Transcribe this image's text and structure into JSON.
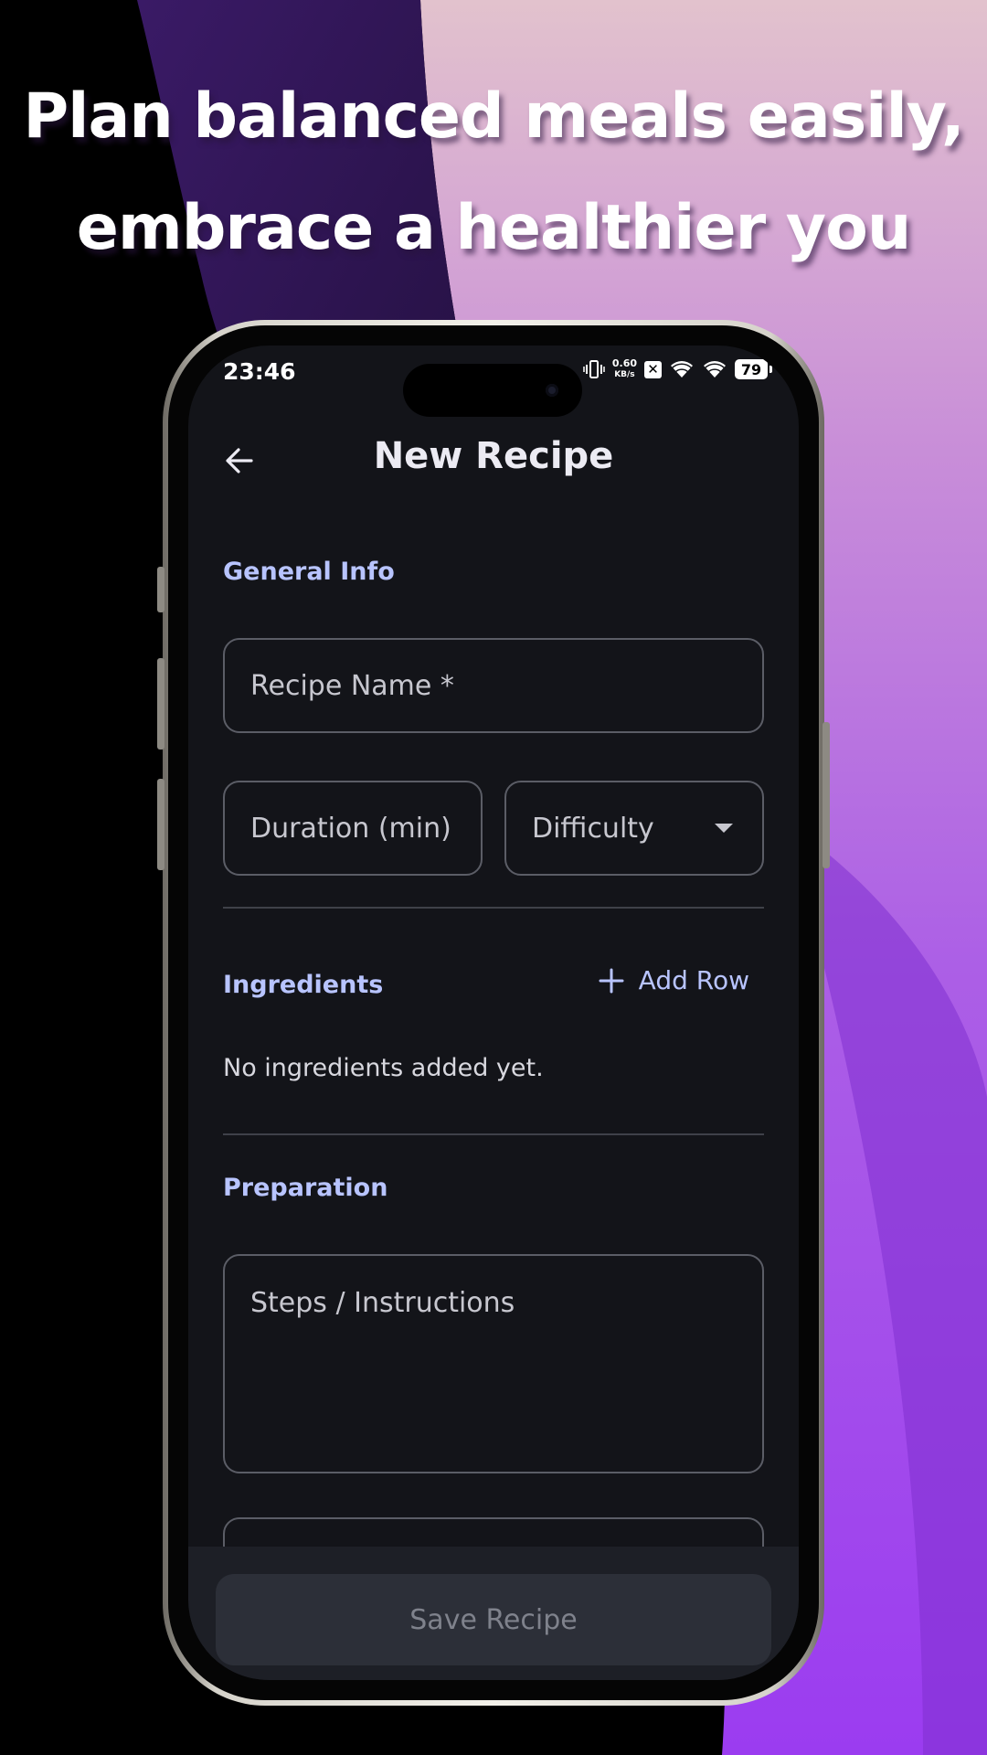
{
  "promo": {
    "headline_line1": "Plan balanced meals easily,",
    "headline_line2": "embrace a healthier you"
  },
  "status_bar": {
    "time": "23:46",
    "net_speed_value": "0.60",
    "net_speed_unit": "KB/s",
    "battery": "79",
    "icons": [
      "vibrate-icon",
      "x-box-icon",
      "wifi-icon",
      "wifi-icon"
    ]
  },
  "header": {
    "title": "New Recipe",
    "back_icon": "arrow-left-icon"
  },
  "general_info": {
    "label": "General Info",
    "recipe_name_placeholder": "Recipe Name *",
    "duration_placeholder": "Duration (min)",
    "difficulty_label": "Difficulty"
  },
  "ingredients": {
    "label": "Ingredients",
    "add_row_label": "Add Row",
    "empty_message": "No ingredients added yet."
  },
  "preparation": {
    "label": "Preparation",
    "steps_placeholder": "Steps / Instructions"
  },
  "footer": {
    "save_label": "Save Recipe"
  },
  "colors": {
    "accent": "#b8c4ff",
    "screen_bg": "#131419",
    "field_border": "#5b5d66"
  }
}
